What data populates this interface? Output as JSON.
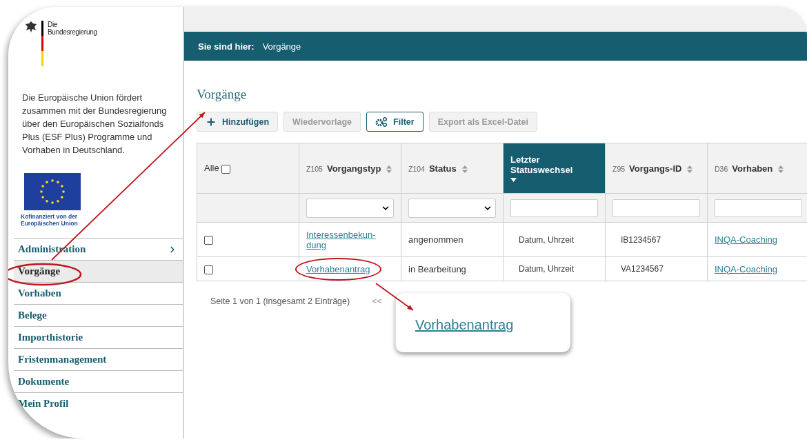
{
  "logo": {
    "line1": "Die",
    "line2": "Bundesregierung"
  },
  "intro": "Die Europäische Union fördert zusammen mit der Bundesregierung über den Europäischen Sozialfonds Plus (ESF Plus) Programme und Vorhaben in Deutschland.",
  "eu_caption": "Kofinanziert von der Europäischen Union",
  "nav": [
    {
      "label": "Administration",
      "has_submenu": true,
      "selected": false
    },
    {
      "label": "Vorgänge",
      "has_submenu": false,
      "selected": true
    },
    {
      "label": "Vorhaben",
      "has_submenu": false,
      "selected": false
    },
    {
      "label": "Belege",
      "has_submenu": false,
      "selected": false
    },
    {
      "label": "Importhistorie",
      "has_submenu": false,
      "selected": false
    },
    {
      "label": "Fristenmanagement",
      "has_submenu": false,
      "selected": false
    },
    {
      "label": "Dokumente",
      "has_submenu": false,
      "selected": false
    },
    {
      "label": "Mein Profil",
      "has_submenu": false,
      "selected": false
    }
  ],
  "breadcrumb": {
    "label": "Sie sind hier:",
    "current": "Vorgänge"
  },
  "title": "Vorgänge",
  "toolbar": [
    {
      "label": "Hinzufügen",
      "kind": "add",
      "disabled": false
    },
    {
      "label": "Wiedervorlage",
      "kind": "plain",
      "disabled": true
    },
    {
      "label": "Filter",
      "kind": "filter",
      "disabled": false
    },
    {
      "label": "Export als Excel-Datei",
      "kind": "plain",
      "disabled": true
    }
  ],
  "table": {
    "select_all": {
      "label": "Alle",
      "checked": false
    },
    "columns": [
      {
        "code": "Z105",
        "label": "Vorgangstyp",
        "sorted": false,
        "kind": "select"
      },
      {
        "code": "Z104",
        "label": "Status",
        "sorted": false,
        "kind": "select"
      },
      {
        "label": "Letzter Statuswechsel",
        "sorted": true,
        "kind": "text"
      },
      {
        "code": "Z95",
        "label": "Vorgangs-ID",
        "sorted": false,
        "kind": "text"
      },
      {
        "code": "D36",
        "label": "Vorhaben",
        "sorted": false,
        "kind": "text"
      }
    ],
    "rows": [
      {
        "checked": false,
        "cells": [
          {
            "kind": "link",
            "text": "Interessenbekun-dung"
          },
          {
            "kind": "text",
            "text": "angenommen"
          },
          {
            "kind": "small",
            "text": "Datum, Uhrzeit"
          },
          {
            "kind": "small",
            "text": "IB1234567"
          },
          {
            "kind": "link",
            "text": "INQA-Coaching"
          }
        ]
      },
      {
        "checked": false,
        "cells": [
          {
            "kind": "link",
            "text": "Vorhabenantrag"
          },
          {
            "kind": "text",
            "text": "in Bearbeitung"
          },
          {
            "kind": "small",
            "text": "Datum, Uhrzeit"
          },
          {
            "kind": "small",
            "text": "VA1234567"
          },
          {
            "kind": "link",
            "text": "INQA-Coaching"
          }
        ]
      }
    ]
  },
  "pagination": {
    "summary": "Seite 1 von 1 (insgesamt 2 Einträge)",
    "first": "<<"
  },
  "callout": {
    "text": "Vorhabenantrag"
  }
}
